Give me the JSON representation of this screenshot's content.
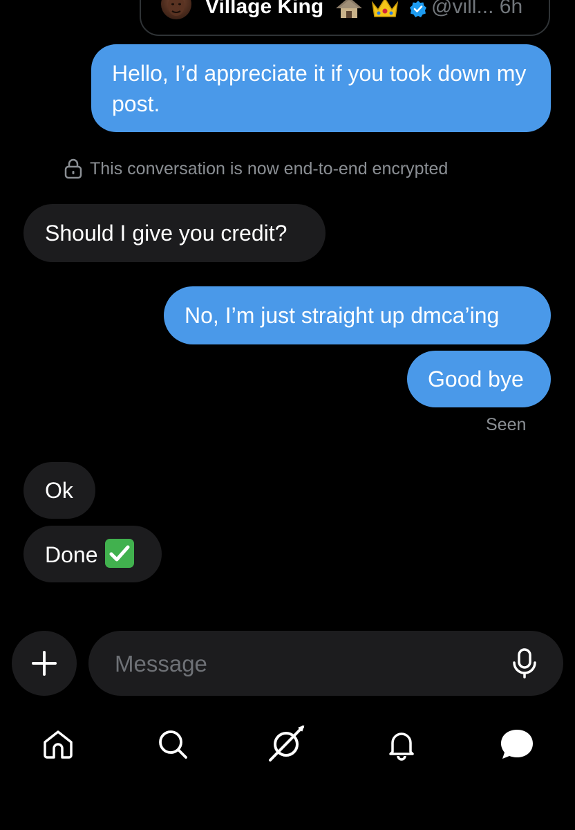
{
  "quoted_post": {
    "author_name": "Village King",
    "emojis": [
      "hut-emoji",
      "crown-emoji"
    ],
    "handle_time": "@vill... 6h"
  },
  "messages": [
    {
      "direction": "outgoing",
      "text": "Hello, I’d appreciate it if you took down my post."
    },
    {
      "direction": "incoming",
      "text": "Should I give you credit?"
    },
    {
      "direction": "outgoing",
      "text": "No, I’m just straight up dmca’ing"
    },
    {
      "direction": "outgoing",
      "text": "Good bye"
    },
    {
      "direction": "incoming",
      "text": "Ok"
    },
    {
      "direction": "incoming",
      "text": "Done",
      "emoji": "check-mark-button-emoji"
    }
  ],
  "encryption_notice": "This conversation is now end-to-end encrypted",
  "seen_label": "Seen",
  "composer": {
    "placeholder": "Message",
    "value": ""
  },
  "bottom_nav": [
    "home-icon",
    "search-icon",
    "grok-icon",
    "notifications-icon",
    "messages-icon"
  ],
  "colors": {
    "background": "#000000",
    "outgoing_bubble": "#4a99e9",
    "incoming_bubble": "#1c1c1e",
    "secondary_text": "#8b8f94",
    "verified_badge": "#1d9bf0"
  }
}
